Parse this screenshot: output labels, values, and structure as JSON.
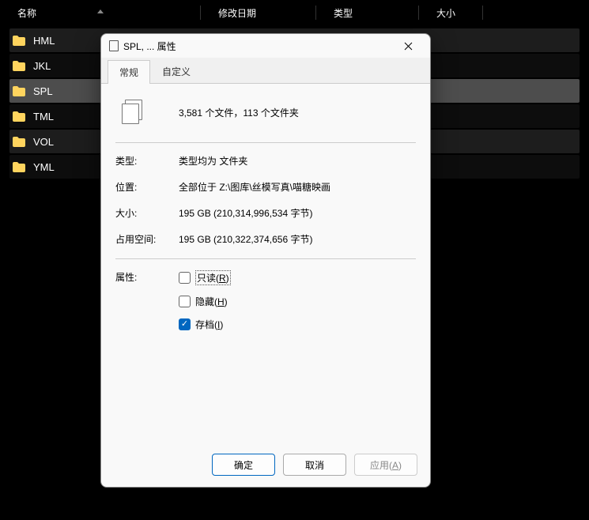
{
  "columns": {
    "name": "名称",
    "date": "修改日期",
    "type": "类型",
    "size": "大小"
  },
  "files": [
    {
      "name": "HML"
    },
    {
      "name": "JKL"
    },
    {
      "name": "SPL"
    },
    {
      "name": "TML"
    },
    {
      "name": "VOL"
    },
    {
      "name": "YML"
    }
  ],
  "dialog": {
    "title": "SPL, ... 属性",
    "tabs": {
      "general": "常规",
      "custom": "自定义"
    },
    "summary": "3,581 个文件，113 个文件夹",
    "labels": {
      "type": "类型:",
      "location": "位置:",
      "size": "大小:",
      "disk": "占用空间:",
      "attributes": "属性:"
    },
    "values": {
      "type": "类型均为 文件夹",
      "location": "全部位于 Z:\\图库\\丝模写真\\喵糖映画",
      "size": "195 GB (210,314,996,534 字节)",
      "disk": "195 GB (210,322,374,656 字节)"
    },
    "attributes": {
      "readonly_prefix": "只读(",
      "readonly_letter": "R",
      "readonly_suffix": ")",
      "hidden_prefix": "隐藏(",
      "hidden_letter": "H",
      "hidden_suffix": ")",
      "archive_prefix": "存档(",
      "archive_letter": "I",
      "archive_suffix": ")"
    },
    "buttons": {
      "ok": "确定",
      "cancel": "取消",
      "apply_prefix": "应用(",
      "apply_letter": "A",
      "apply_suffix": ")"
    }
  }
}
